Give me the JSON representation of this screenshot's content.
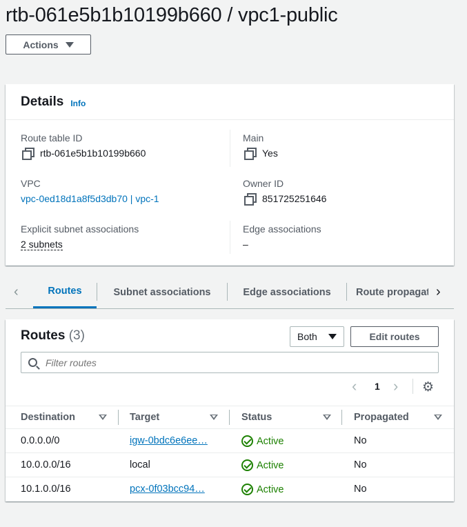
{
  "header": {
    "title": "rtb-061e5b1b10199b660 / vpc1-public",
    "actions_label": "Actions"
  },
  "details": {
    "title": "Details",
    "info_label": "Info",
    "route_table_id_label": "Route table ID",
    "route_table_id": "rtb-061e5b1b10199b660",
    "main_label": "Main",
    "main_value": "Yes",
    "vpc_label": "VPC",
    "vpc_value": "vpc-0ed18d1a8f5d3db70 | vpc-1",
    "owner_id_label": "Owner ID",
    "owner_id": "851725251646",
    "explicit_subnet_label": "Explicit subnet associations",
    "explicit_subnet_value": "2 subnets",
    "edge_label": "Edge associations",
    "edge_value": "–"
  },
  "tabs": [
    {
      "label": "Routes",
      "active": true
    },
    {
      "label": "Subnet associations",
      "active": false
    },
    {
      "label": "Edge associations",
      "active": false
    },
    {
      "label": "Route propagation",
      "active": false
    }
  ],
  "routes": {
    "title": "Routes",
    "count": "(3)",
    "filter_select": "Both",
    "edit_label": "Edit routes",
    "filter_placeholder": "Filter routes",
    "page": "1",
    "columns": [
      "Destination",
      "Target",
      "Status",
      "Propagated"
    ],
    "rows": [
      {
        "destination": "0.0.0.0/0",
        "target": "igw-0bdc6e6ee…",
        "target_link": true,
        "status": "Active",
        "propagated": "No"
      },
      {
        "destination": "10.0.0.0/16",
        "target": "local",
        "target_link": false,
        "status": "Active",
        "propagated": "No"
      },
      {
        "destination": "10.1.0.0/16",
        "target": "pcx-0f03bcc94…",
        "target_link": true,
        "status": "Active",
        "propagated": "No"
      }
    ]
  },
  "icons": {
    "copy": "copy-icon",
    "search": "search-icon",
    "settings": "gear-icon",
    "status": "check-circle-icon"
  },
  "colors": {
    "link": "#0073bb",
    "success": "#1d8102"
  }
}
